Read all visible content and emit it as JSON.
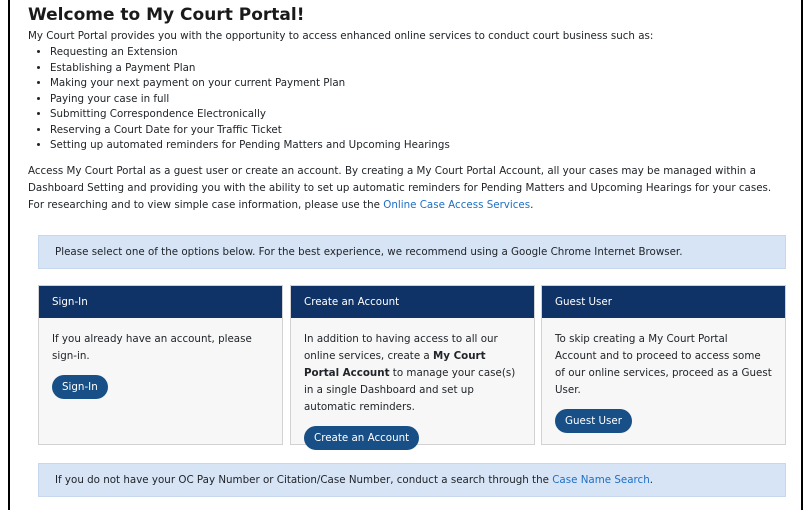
{
  "page": {
    "title": "Welcome to My Court Portal!",
    "intro": "My Court Portal provides you with the opportunity to access enhanced online services to conduct court business such as:",
    "services": [
      "Requesting an Extension",
      "Establishing a Payment Plan",
      "Making your next payment on your current Payment Plan",
      "Paying your case in full",
      "Submitting Correspondence Electronically",
      "Reserving a Court Date for your Traffic Ticket",
      "Setting up automated reminders for Pending Matters and Upcoming Hearings"
    ],
    "access_text": "Access My Court Portal as a guest user or create an account. By creating a My Court Portal Account, all your cases may be managed within a Dashboard Setting and providing you with the ability to set up automatic reminders for Pending Matters and Upcoming Hearings for your cases. For researching and to view simple case information, please use the ",
    "access_link": "Online Case Access Services",
    "access_end": "."
  },
  "notice_top": "Please select one of the options below. For the best experience, we recommend using a Google Chrome Internet Browser.",
  "cards": {
    "signin": {
      "header": "Sign-In",
      "body": "If you already have an account, please sign-in.",
      "button": "Sign-In"
    },
    "create": {
      "header": "Create an Account",
      "body_pre": "In addition to having access to all our online services, create a ",
      "body_bold": "My Court Portal Account",
      "body_post": " to manage your case(s) in a single Dashboard and set up automatic reminders.",
      "button": "Create an Account"
    },
    "guest": {
      "header": "Guest User",
      "body": "To skip creating a My Court Portal Account and to proceed to access some of our online services, proceed as a Guest User.",
      "button": "Guest User"
    }
  },
  "notice_bottom": {
    "text": "If you do not have your OC Pay Number or Citation/Case Number, conduct a search through the ",
    "link": "Case Name Search",
    "end": "."
  },
  "colors": {
    "card_header": "#0f3366",
    "button": "#174f86",
    "notice_bg": "#d6e4f6",
    "link": "#1f6fc5"
  }
}
